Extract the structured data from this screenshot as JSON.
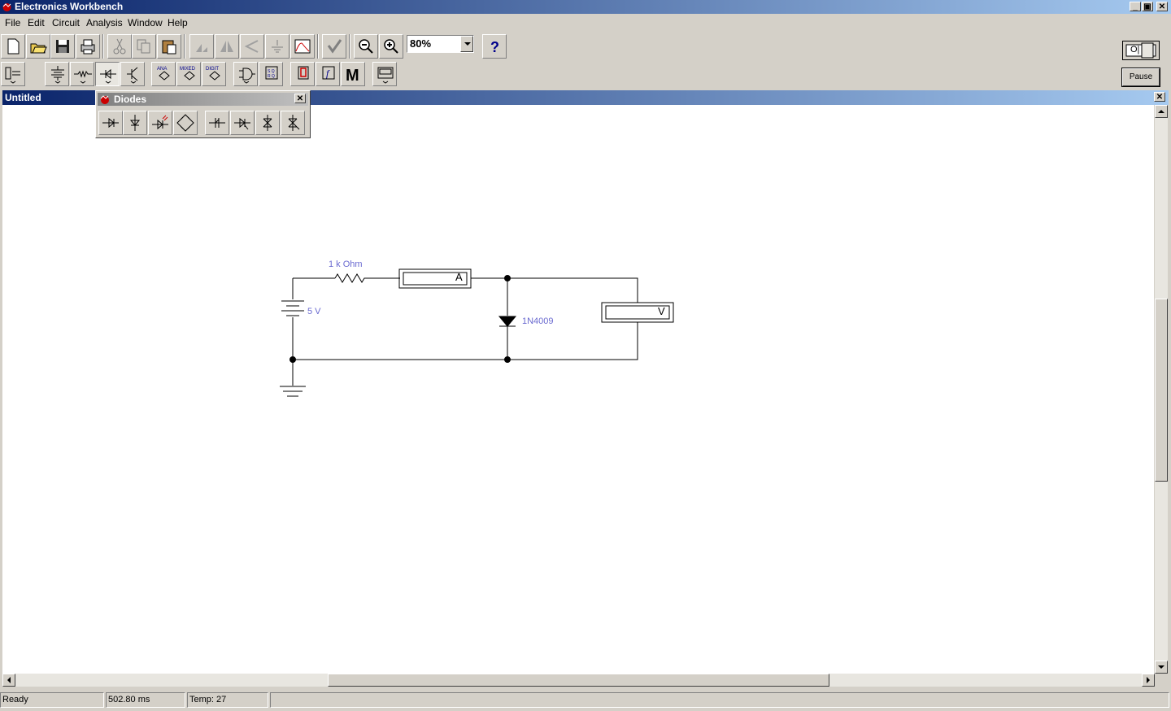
{
  "app": {
    "title": "Electronics Workbench"
  },
  "menu": [
    "File",
    "Edit",
    "Circuit",
    "Analysis",
    "Window",
    "Help"
  ],
  "toolbar": {
    "zoom_value": "80%"
  },
  "controls": {
    "power_label": "O|",
    "pause_label": "Pause"
  },
  "document": {
    "title": "Untitled"
  },
  "palette": {
    "title": "Diodes"
  },
  "circuit": {
    "resistor_label": "1 k Ohm",
    "battery_label": "5 V",
    "diode_label": "1N4009",
    "ammeter_label": "A",
    "voltmeter_label": "V"
  },
  "status": {
    "state": "Ready",
    "time": "502.80 ms",
    "temp": "Temp:  27"
  }
}
